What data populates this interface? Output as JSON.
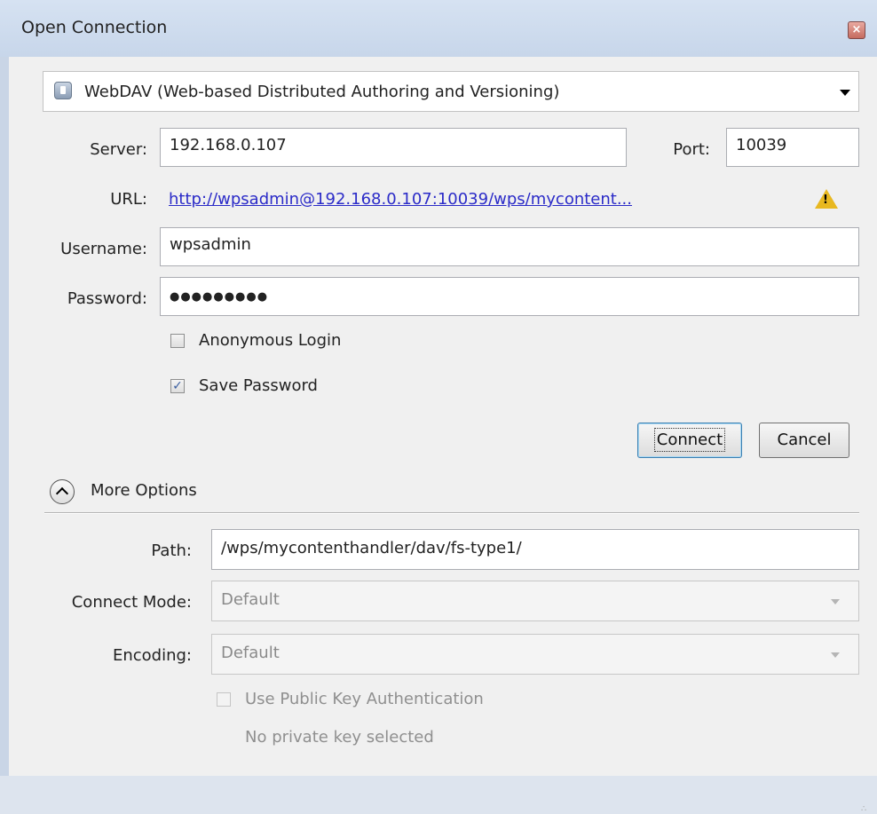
{
  "window": {
    "title": "Open Connection",
    "close_icon": "close-icon"
  },
  "protocol": {
    "selected": "WebDAV (Web-based Distributed Authoring and Versioning)",
    "icon": "drive-icon"
  },
  "server": {
    "label": "Server:",
    "value": "192.168.0.107"
  },
  "port": {
    "label": "Port:",
    "value": "10039"
  },
  "url": {
    "label": "URL:",
    "value": "http://wpsadmin@192.168.0.107:10039/wps/mycontent...",
    "warning_icon": "warning-icon"
  },
  "username": {
    "label": "Username:",
    "value": "wpsadmin"
  },
  "password": {
    "label": "Password:",
    "value": "●●●●●●●●●"
  },
  "anonymous_login": {
    "label": "Anonymous Login",
    "checked": false
  },
  "save_password": {
    "label": "Save Password",
    "checked": true
  },
  "buttons": {
    "connect": "Connect",
    "cancel": "Cancel"
  },
  "more_options": {
    "label": "More Options",
    "expanded": true
  },
  "path": {
    "label": "Path:",
    "value": "/wps/mycontenthandler/dav/fs-type1/"
  },
  "connect_mode": {
    "label": "Connect Mode:",
    "value": "Default"
  },
  "encoding": {
    "label": "Encoding:",
    "value": "Default"
  },
  "public_key": {
    "label": "Use Public Key Authentication",
    "checked": false,
    "status": "No private key selected"
  },
  "colors": {
    "link": "#2b2bc8",
    "titlebar": "#d6e2f2",
    "warning": "#e8b820"
  }
}
